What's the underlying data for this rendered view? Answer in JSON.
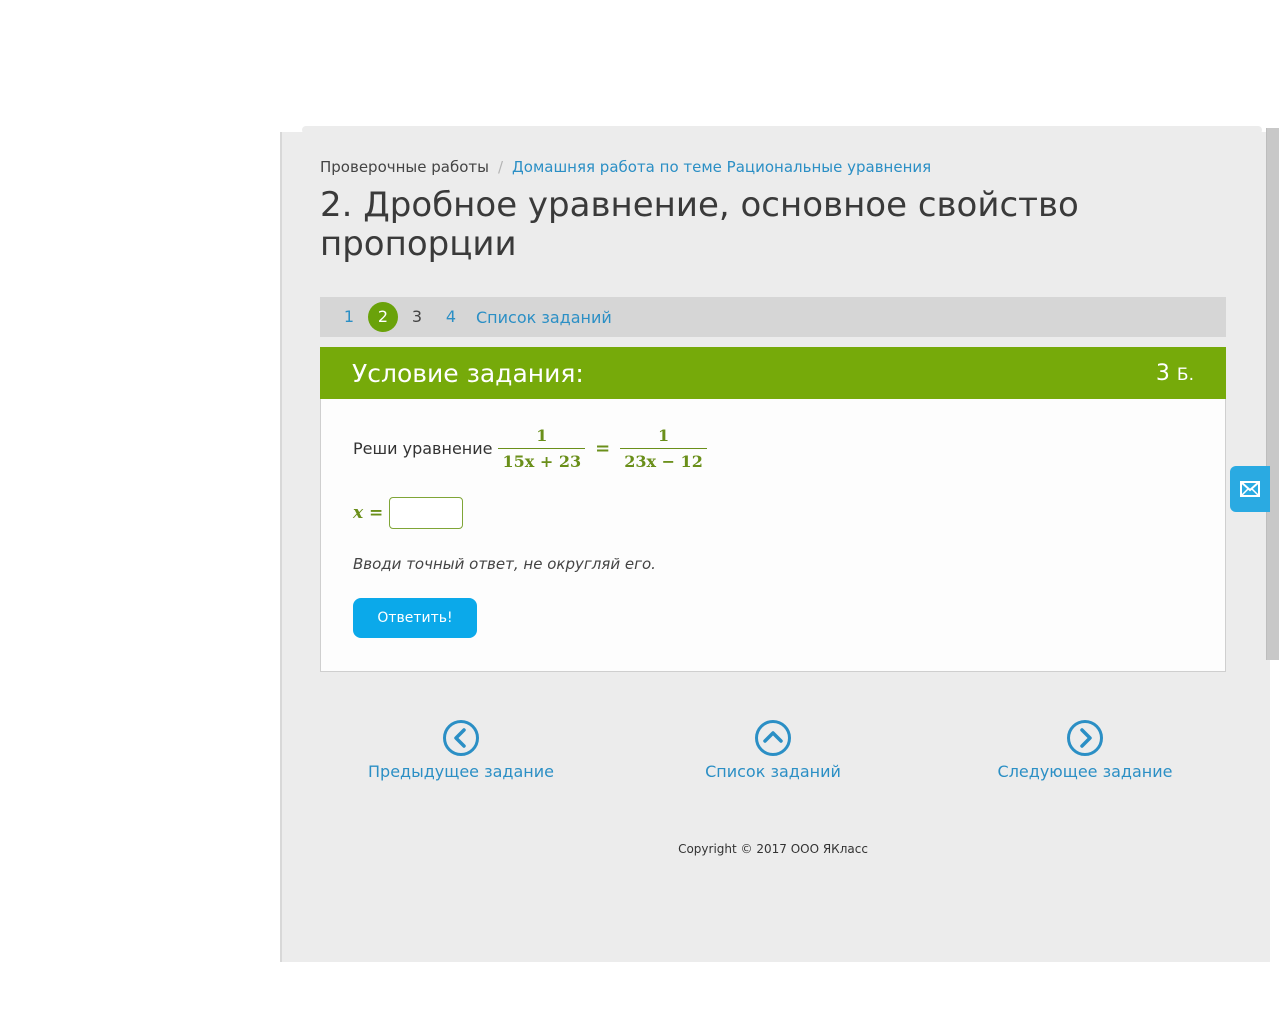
{
  "breadcrumb": {
    "root": "Проверочные работы",
    "separator": "/",
    "current": "Домашняя работа по теме Рациональные уравнения"
  },
  "page_title": "2. Дробное уравнение, основное свойство пропорции",
  "pager": {
    "pages": [
      "1",
      "2",
      "3",
      "4"
    ],
    "current_page": "2",
    "list_label": "Список заданий"
  },
  "task": {
    "header_title": "Условие задания:",
    "points_value": "3",
    "points_unit": "Б.",
    "prompt": "Реши уравнение",
    "left_numerator": "1",
    "left_denominator": "15x + 23",
    "equals": "=",
    "right_numerator": "1",
    "right_denominator": "23x − 12",
    "answer_label": "x =",
    "answer_value": "",
    "hint": "Вводи точный ответ, не округляй его.",
    "submit_label": "Ответить!"
  },
  "navigation": {
    "prev_label": "Предыдущее задание",
    "list_label": "Список заданий",
    "next_label": "Следующее задание"
  },
  "copyright": "Copyright © 2017 ООО ЯКласс",
  "colors": {
    "accent_green": "#76aa0a",
    "link_blue": "#2b8fc5",
    "button_blue": "#0ba9ea",
    "math_green": "#6a8f1a"
  },
  "icons": {
    "prev": "chevron-left-circle-icon",
    "list": "chevron-up-circle-icon",
    "next": "chevron-right-circle-icon",
    "feedback": "envelope-icon"
  }
}
